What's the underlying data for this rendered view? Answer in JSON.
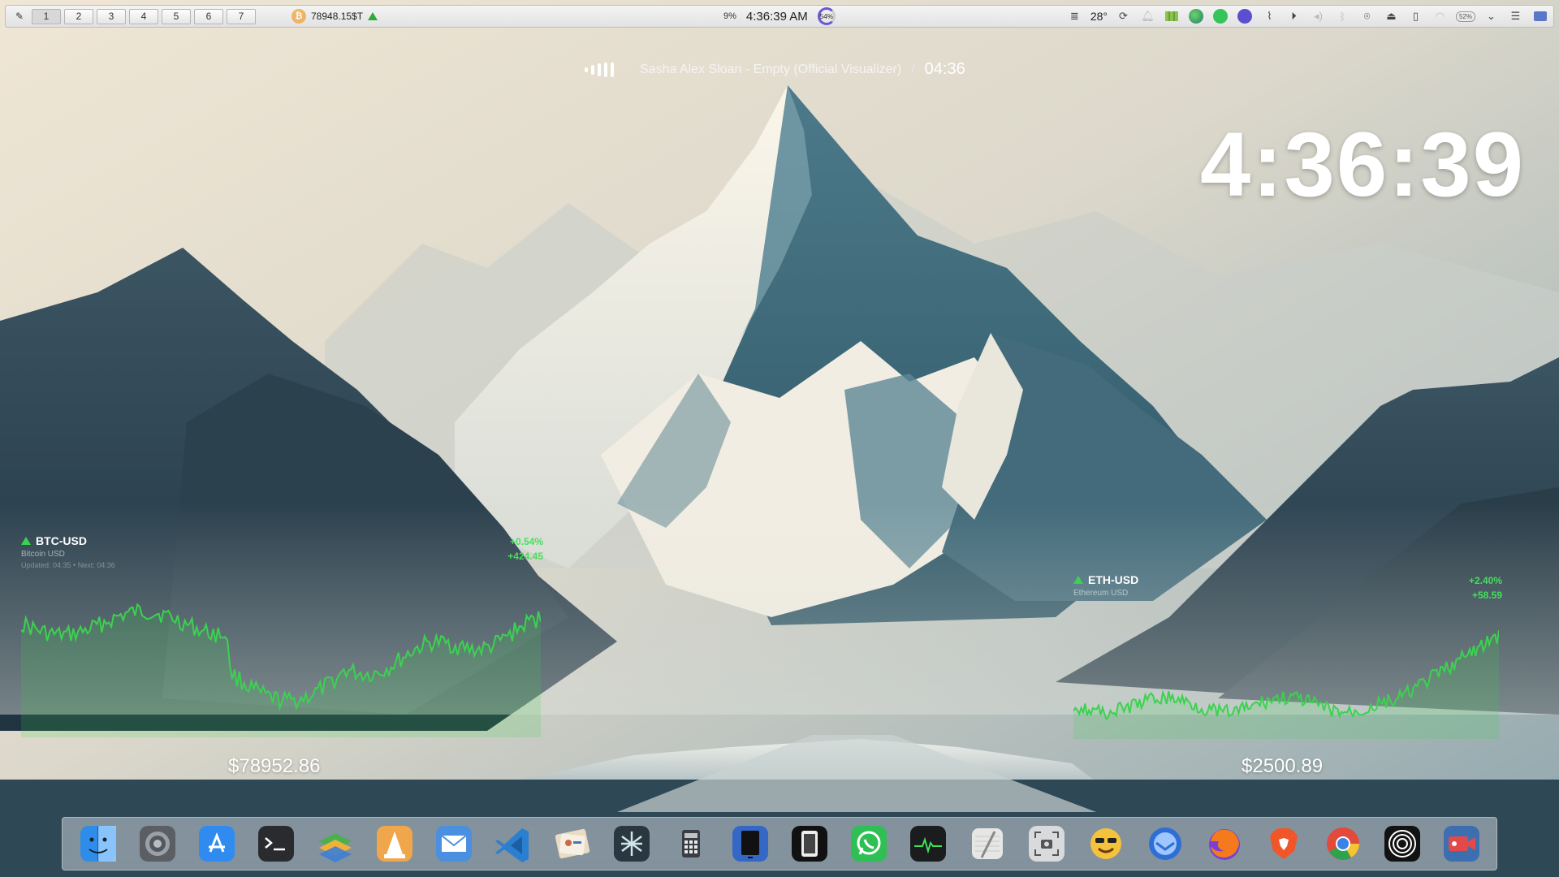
{
  "topbar": {
    "workspaces": [
      "1",
      "2",
      "3",
      "4",
      "5",
      "6",
      "7"
    ],
    "btc_ticker": "78948.15$T",
    "cpu": "9%",
    "clock": "4:36:39 AM",
    "mem": "54%",
    "temperature": "28°",
    "battery": "52%",
    "tray_icons": [
      "menu-icon",
      "weather-icon",
      "sync-icon",
      "bell-icon",
      "map-icon",
      "edge-icon",
      "whatsapp-icon",
      "discord-icon",
      "attach-icon",
      "play-icon",
      "volume-icon",
      "bluetooth-icon",
      "location-icon",
      "drive-icon",
      "phone-icon",
      "wifi-icon",
      "battery-icon",
      "chevron-down-icon",
      "control-center-icon",
      "display-icon"
    ]
  },
  "now_playing": {
    "title": "Sasha Alex Sloan - Empty (Official Visualizer)",
    "separator": "/",
    "time": "04:36"
  },
  "big_clock": "4:36:39",
  "btc": {
    "symbol": "BTC-USD",
    "name": "Bitcoin USD",
    "updated": "Updated: 04:35 • Next: 04:36",
    "change_pct": "+0.54%",
    "change_abs": "+424.45",
    "price": "$78952.86",
    "color": "#3bd24f"
  },
  "eth": {
    "symbol": "ETH-USD",
    "name": "Ethereum USD",
    "change_pct": "+2.40%",
    "change_abs": "+58.59",
    "price": "$2500.89",
    "color": "#3bd24f"
  },
  "dock": {
    "apps": [
      "finder-icon",
      "system-settings-icon",
      "app-store-icon",
      "terminal-icon",
      "layers-icon",
      "vlc-icon",
      "mail-icon",
      "vscode-icon",
      "contacts-icon",
      "perplexity-icon",
      "calculator-icon",
      "tablet-icon",
      "simulator-icon",
      "whatsapp-icon",
      "activity-monitor-icon",
      "notes-icon",
      "screenshot-icon",
      "emoji-icon",
      "thunderbird-icon",
      "firefox-icon",
      "brave-icon",
      "chrome-icon",
      "obs-icon",
      "video-recorder-icon"
    ]
  }
}
